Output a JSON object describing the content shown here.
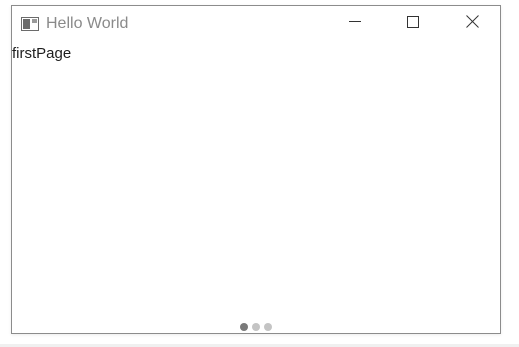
{
  "window": {
    "title": "Hello World",
    "controls": {
      "minimize": "minimize",
      "maximize": "maximize",
      "close": "close"
    }
  },
  "content": {
    "page_label": "firstPage"
  },
  "pager": {
    "total_pages": 3,
    "current_page": 1
  },
  "icons": {
    "app": "app-window-icon",
    "minimize": "minimize-icon",
    "maximize": "maximize-icon",
    "close": "close-icon"
  },
  "colors": {
    "title_text": "#8a8a8a",
    "dot_active": "#7a7a7a",
    "dot_inactive": "#c4c4c4"
  }
}
